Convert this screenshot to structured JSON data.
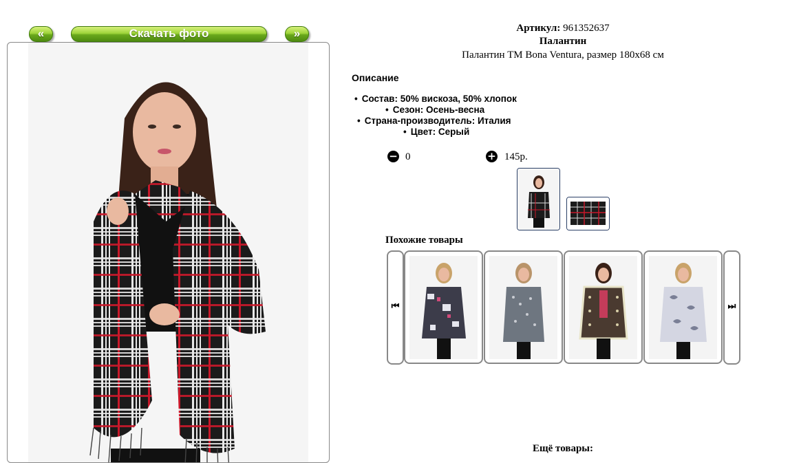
{
  "nav": {
    "prev_label": "«",
    "download_label": "Скачать фото",
    "next_label": "»"
  },
  "product": {
    "article_label": "Артикул:",
    "article_value": "961352637",
    "type": "Палантин",
    "description": "Палантин ТМ Bona Ventura, размер 180x68 см"
  },
  "details": {
    "title": "Описание",
    "specs": [
      "Состав: 50% вискоза, 50% хлопок",
      "Сезон: Осень-весна",
      "Страна-производитель: Италия",
      "Цвет: Серый"
    ]
  },
  "order": {
    "minus_icon": "minus-circle-icon",
    "plus_icon": "plus-circle-icon",
    "quantity": "0",
    "price": "145р."
  },
  "similar": {
    "title": "Похожие товары",
    "prev_icon": "skip-back-icon",
    "next_icon": "skip-forward-icon"
  },
  "more": {
    "title": "Ещё товары:"
  },
  "colors": {
    "button_green": "#6aa81c",
    "thumb_border": "#2a3f66",
    "frame_border": "#888888"
  }
}
